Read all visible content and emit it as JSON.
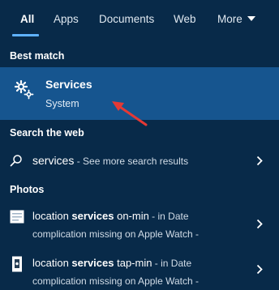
{
  "tabs": [
    {
      "label": "All",
      "active": true
    },
    {
      "label": "Apps"
    },
    {
      "label": "Documents"
    },
    {
      "label": "Web"
    },
    {
      "label": "More"
    }
  ],
  "best_match": {
    "header": "Best match",
    "title": "Services",
    "subtitle": "System",
    "icon": "gear-icon"
  },
  "web_section": {
    "header": "Search the web",
    "query": "services",
    "suffix": " - See more search results"
  },
  "photos_section": {
    "header": "Photos",
    "items": [
      {
        "pre": "location ",
        "bold": "services",
        "post": " on-min",
        "meta": " - in Date",
        "line2": "complication missing on Apple Watch -"
      },
      {
        "pre": "location ",
        "bold": "services",
        "post": " tap-min",
        "meta": " - in Date",
        "line2": "complication missing on Apple Watch -"
      }
    ]
  },
  "colors": {
    "background": "#082a49",
    "highlight": "#16558f",
    "accent": "#5fb2ff",
    "annotation_arrow": "#e53935"
  }
}
